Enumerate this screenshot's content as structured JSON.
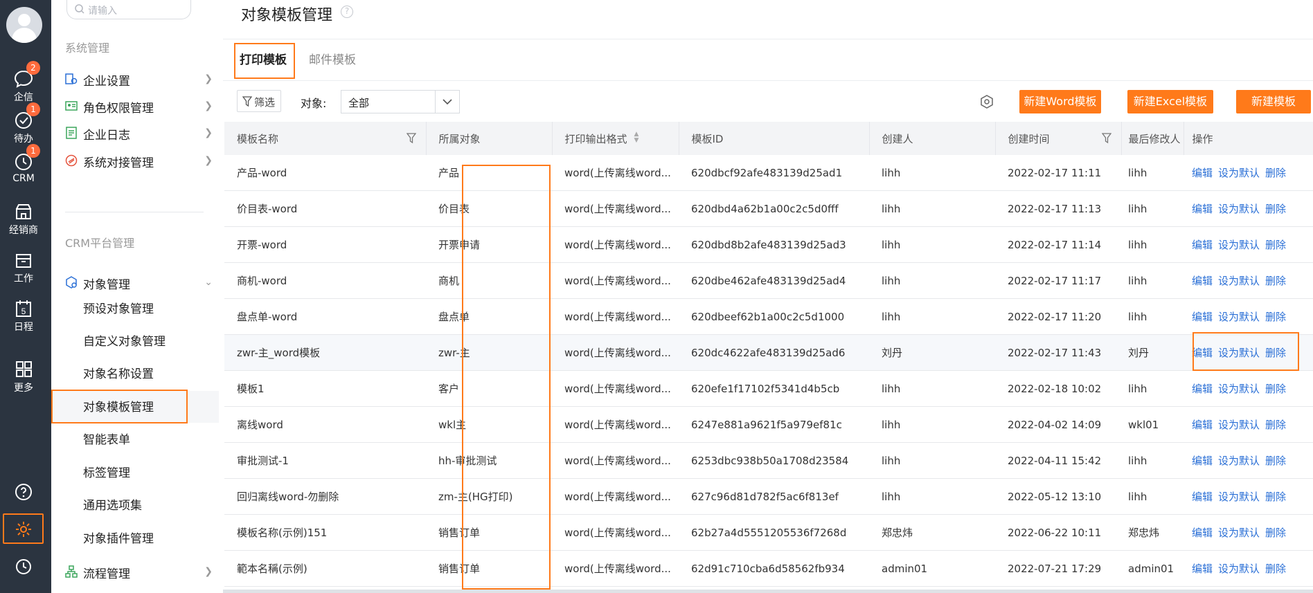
{
  "rail": {
    "items": [
      {
        "label": "企信",
        "badge": "2"
      },
      {
        "label": "待办",
        "badge": "1"
      },
      {
        "label": "CRM",
        "badge": "1"
      },
      {
        "label": "经销商"
      },
      {
        "label": "工作"
      },
      {
        "label": "日程"
      },
      {
        "label": "更多"
      }
    ],
    "calendar_day": "5"
  },
  "subnav": {
    "search_placeholder": "请输入",
    "section1": "系统管理",
    "items1": [
      "企业设置",
      "角色权限管理",
      "企业日志",
      "系统对接管理"
    ],
    "section2": "CRM平台管理",
    "group": "对象管理",
    "sub_items": [
      "预设对象管理",
      "自定义对象管理",
      "对象名称设置",
      "对象模板管理",
      "智能表单",
      "标签管理",
      "通用选项集",
      "对象插件管理"
    ],
    "last_item": "流程管理"
  },
  "main": {
    "title": "对象模板管理",
    "tabs": [
      "打印模板",
      "邮件模板"
    ],
    "filter_label": "筛选",
    "object_label": "对象:",
    "object_value": "全部",
    "buttons": [
      "新建Word模板",
      "新建Excel模板",
      "新建模板"
    ],
    "columns": [
      "模板名称",
      "所属对象",
      "打印输出格式",
      "模板ID",
      "创建人",
      "创建时间",
      "最后修改人",
      "操作"
    ],
    "actions": [
      "编辑",
      "设为默认",
      "删除"
    ],
    "rows": [
      {
        "name": "产品-word",
        "object": "产品",
        "format": "word(上传离线word...",
        "id": "620dbcf92afe483139d25ad1",
        "creator": "lihh",
        "created": "2022-02-17 11:11",
        "modifier": "lihh"
      },
      {
        "name": "价目表-word",
        "object": "价目表",
        "format": "word(上传离线word...",
        "id": "620dbd4a62b1a00c2c5d0fff",
        "creator": "lihh",
        "created": "2022-02-17 11:13",
        "modifier": "lihh"
      },
      {
        "name": "开票-word",
        "object": "开票申请",
        "format": "word(上传离线word...",
        "id": "620dbd8b2afe483139d25ad3",
        "creator": "lihh",
        "created": "2022-02-17 11:14",
        "modifier": "lihh"
      },
      {
        "name": "商机-word",
        "object": "商机",
        "format": "word(上传离线word...",
        "id": "620dbe462afe483139d25ad4",
        "creator": "lihh",
        "created": "2022-02-17 11:17",
        "modifier": "lihh"
      },
      {
        "name": "盘点单-word",
        "object": "盘点单",
        "format": "word(上传离线word...",
        "id": "620dbeef62b1a00c2c5d1000",
        "creator": "lihh",
        "created": "2022-02-17 11:20",
        "modifier": "lihh"
      },
      {
        "name": "zwr-主_word模板",
        "object": "zwr-主",
        "format": "word(上传离线word...",
        "id": "620dc4622afe483139d25ad6",
        "creator": "刘丹",
        "created": "2022-02-17 11:43",
        "modifier": "刘丹"
      },
      {
        "name": "模板1",
        "object": "客户",
        "format": "word(上传离线word...",
        "id": "620efe1f17102f5341d4b5cb",
        "creator": "lihh",
        "created": "2022-02-18 10:02",
        "modifier": "lihh"
      },
      {
        "name": "离线word",
        "object": "wkl主",
        "format": "word(上传离线word...",
        "id": "6247e881a9621f5a979ef81c",
        "creator": "lihh",
        "created": "2022-04-02 14:09",
        "modifier": "wkl01"
      },
      {
        "name": "审批测试-1",
        "object": "hh-审批测试",
        "format": "word(上传离线word...",
        "id": "6253dbc938b50a1708d23584",
        "creator": "lihh",
        "created": "2022-04-11 15:42",
        "modifier": "lihh"
      },
      {
        "name": "回归离线word-勿删除",
        "object": "zm-主(HG打印)",
        "format": "word(上传离线word...",
        "id": "627c96d81d782f5ac6f813ef",
        "creator": "lihh",
        "created": "2022-05-12 13:10",
        "modifier": "lihh"
      },
      {
        "name": "模板名称(示例)151",
        "object": "销售订单",
        "format": "word(上传离线word...",
        "id": "62b27a4d5551205536f7268d",
        "creator": "郑忠炜",
        "created": "2022-06-22 10:11",
        "modifier": "郑忠炜"
      },
      {
        "name": "範本名稱(示例)",
        "object": "销售订单",
        "format": "word(上传离线word...",
        "id": "62d91c710cba6d58562fb934",
        "creator": "admin01",
        "created": "2022-07-21 17:29",
        "modifier": "admin01"
      }
    ]
  },
  "colors": {
    "accent": "#ff7a1a",
    "link": "#2a6fd6",
    "rail": "#2b3440"
  }
}
